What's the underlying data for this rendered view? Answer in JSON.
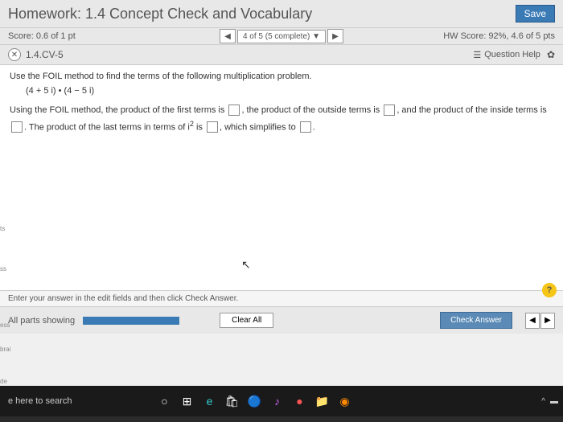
{
  "header": {
    "title": "Homework: 1.4 Concept Check and Vocabulary",
    "save": "Save"
  },
  "subheader": {
    "score": "Score: 0.6 of 1 pt",
    "pager_label": "4 of 5 (5 complete)",
    "hw_score": "HW Score: 92%, 4.6 of 5 pts"
  },
  "question_bar": {
    "number": "1.4.CV-5",
    "help": "Question Help"
  },
  "content": {
    "prompt": "Use the FOIL method to find the terms of the following multiplication problem.",
    "expression": "(4 + 5 i) • (4 − 5 i)",
    "foil_p1": "Using the FOIL method, the product of the first terms is ",
    "foil_p2": ", the product of the outside terms is ",
    "foil_p3": ", and the product of the inside terms is ",
    "foil_p4": ". The product of the last terms in terms of i",
    "foil_p5": " is ",
    "foil_p6": ", which simplifies to ",
    "foil_p7": "."
  },
  "hint": "Enter your answer in the edit fields and then click Check Answer.",
  "footer": {
    "parts": "All parts showing",
    "clear": "Clear All",
    "check": "Check Answer"
  },
  "taskbar": {
    "search": "e here to search"
  },
  "side": {
    "t1": "ts",
    "t2": "ss",
    "t3": "ess",
    "t4": "brai",
    "t5": "de"
  }
}
